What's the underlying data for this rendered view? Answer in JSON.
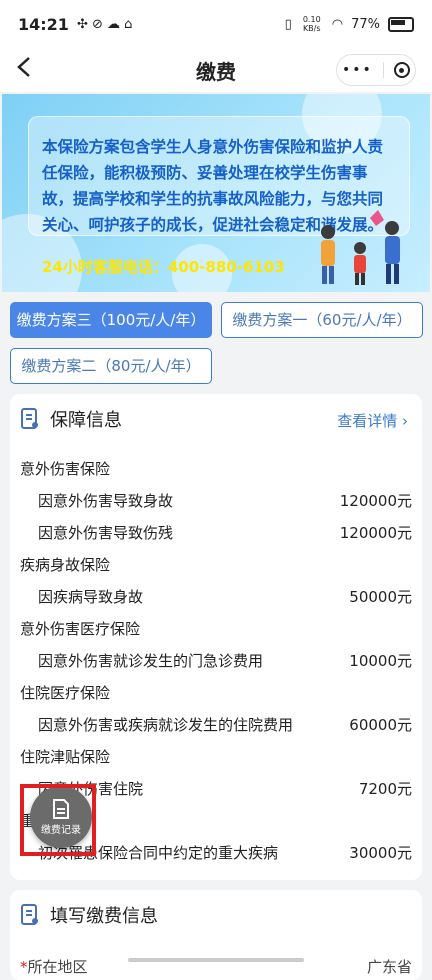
{
  "status": {
    "time": "14:21",
    "net": "0.10 KB/s",
    "battery": "77%"
  },
  "nav": {
    "back": "‹",
    "title": "缴费",
    "dots": "•••"
  },
  "banner": {
    "text": "本保险方案包含学生人身意外伤害保险和监护人责任保险，能积极预防、妥善处理在校学生伤害事故，提高学校和学生的抗事故风险能力，与您共同关心、呵护孩子的成长，促进社会稳定和谐发展。",
    "phone": "24小时客服电话：400-880-6103"
  },
  "plans": [
    {
      "label": "缴费方案三（100元/人/年）",
      "active": true
    },
    {
      "label": "缴费方案一（60元/人/年）",
      "active": false
    },
    {
      "label": "缴费方案二（80元/人/年）",
      "active": false
    }
  ],
  "coverage": {
    "title": "保障信息",
    "more": "查看详情",
    "categories": [
      {
        "name": "意外伤害保险",
        "items": [
          {
            "label": "因意外伤害导致身故",
            "amount": "120000元"
          },
          {
            "label": "因意外伤害导致伤残",
            "amount": "120000元"
          }
        ]
      },
      {
        "name": "疾病身故保险",
        "items": [
          {
            "label": "因疾病导致身故",
            "amount": "50000元"
          }
        ]
      },
      {
        "name": "意外伤害医疗保险",
        "items": [
          {
            "label": "因意外伤害就诊发生的门急诊费用",
            "amount": "10000元"
          }
        ]
      },
      {
        "name": "住院医疗保险",
        "items": [
          {
            "label": "因意外伤害或疾病就诊发生的住院费用",
            "amount": "60000元"
          }
        ]
      },
      {
        "name": "住院津贴保险",
        "items": [
          {
            "label": "因意外伤害住院",
            "amount": "7200元"
          }
        ]
      },
      {
        "name": "重大疾病",
        "items": [
          {
            "label": "初次罹患保险合同中约定的重大疾病",
            "amount": "30000元"
          }
        ]
      }
    ]
  },
  "fill": {
    "title": "填写缴费信息",
    "region_label": "所在地区",
    "region_value": "广东省"
  },
  "fab": {
    "label": "缴费记录"
  },
  "colors": {
    "primary": "#4a86e8",
    "link": "#3a7bd5",
    "phone": "#ffe600",
    "highlight": "#e02020"
  }
}
